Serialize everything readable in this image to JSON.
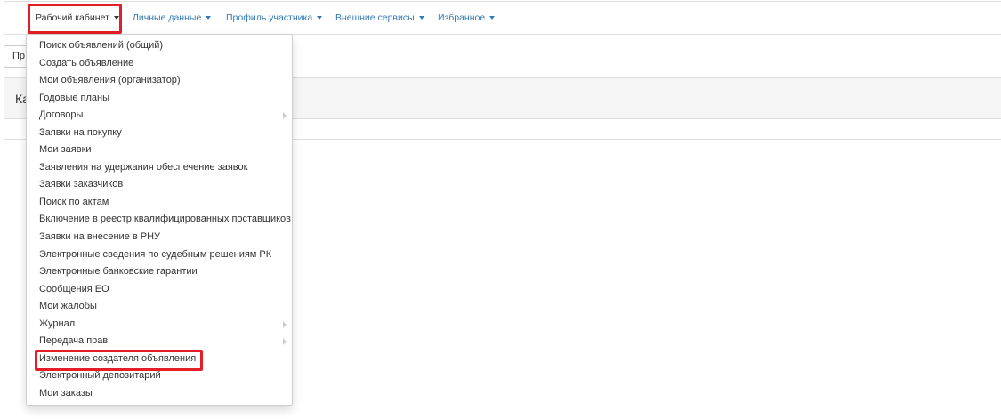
{
  "navbar": {
    "items": [
      {
        "label": "Рабочий кабинет"
      },
      {
        "label": "Личные данные"
      },
      {
        "label": "Профиль участника"
      },
      {
        "label": "Внешние сервисы"
      },
      {
        "label": "Избранное"
      }
    ]
  },
  "page": {
    "button_label": "Пр",
    "panel_heading": "Ка"
  },
  "dropdown": {
    "items": [
      {
        "label": "Поиск объявлений (общий)"
      },
      {
        "label": "Создать объявление"
      },
      {
        "label": "Мои объявления (организатор)"
      },
      {
        "label": "Годовые планы"
      },
      {
        "label": "Договоры"
      },
      {
        "label": "Заявки на покупку"
      },
      {
        "label": "Мои заявки"
      },
      {
        "label": "Заявления на удержания обеспечение заявок"
      },
      {
        "label": "Заявки заказчиков"
      },
      {
        "label": "Поиск по актам"
      },
      {
        "label": "Включение в реестр квалифицированных поставщиков"
      },
      {
        "label": "Заявки на внесение в РНУ"
      },
      {
        "label": "Электронные сведения по судебным решениям РК"
      },
      {
        "label": "Электронные банковские гарантии"
      },
      {
        "label": "Сообщения ЕО"
      },
      {
        "label": "Мои жалобы"
      },
      {
        "label": "Журнал"
      },
      {
        "label": "Передача прав"
      },
      {
        "label": "Изменение создателя объявления"
      },
      {
        "label": "Электронный депозитарий"
      },
      {
        "label": "Мои заказы"
      }
    ]
  },
  "colors": {
    "link": "#337ab7",
    "highlight": "#e41e26"
  }
}
